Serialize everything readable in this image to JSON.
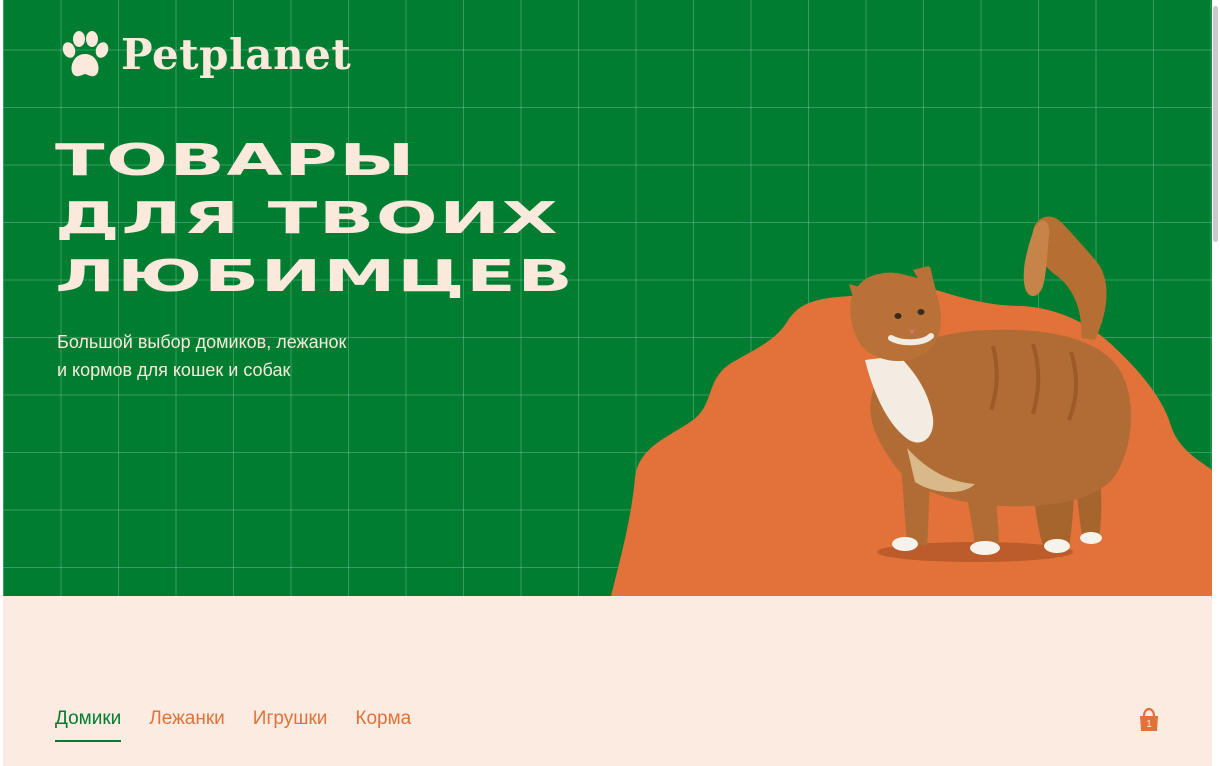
{
  "brand": {
    "name": "Petplanet",
    "logo_icon": "paw-icon"
  },
  "hero": {
    "headline_lines": [
      "ТОВАРЫ",
      "ДЛЯ ТВОИХ",
      "ЛЮБИМЦЕВ"
    ],
    "subtitle_lines": [
      "Большой выбор домиков, лежанок",
      "и кормов для кошек и собак"
    ],
    "image": "orange-cat-on-orange-blob"
  },
  "nav": {
    "items": [
      {
        "label": "Домики",
        "active": true
      },
      {
        "label": "Лежанки",
        "active": false
      },
      {
        "label": "Игрушки",
        "active": false
      },
      {
        "label": "Корма",
        "active": false
      }
    ]
  },
  "cart": {
    "icon": "shopping-bag-icon",
    "count": "1"
  },
  "colors": {
    "green": "#007d31",
    "cream": "#fbe9dc",
    "orange": "#e2723a",
    "bottom_bg": "#fbebe0"
  }
}
